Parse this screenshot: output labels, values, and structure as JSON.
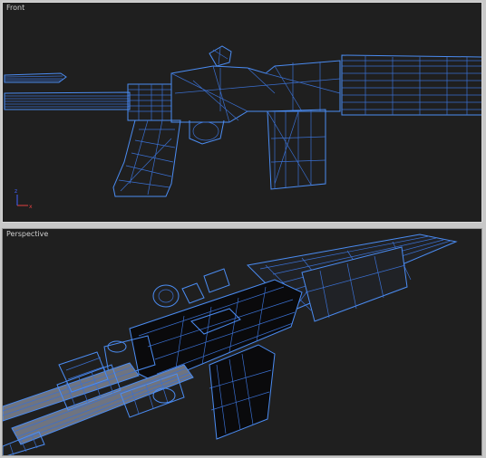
{
  "viewports": {
    "front": {
      "label": "Front"
    },
    "perspective": {
      "label": "Perspective"
    }
  },
  "axis_gizmo": {
    "x_color": "#e04040",
    "y_color": "#40c040",
    "z_color": "#4060ff"
  },
  "colors": {
    "wireframe": "#4b8cf2",
    "viewport_bg": "#1f1f1f",
    "frame_bg": "#c8c8c8"
  }
}
